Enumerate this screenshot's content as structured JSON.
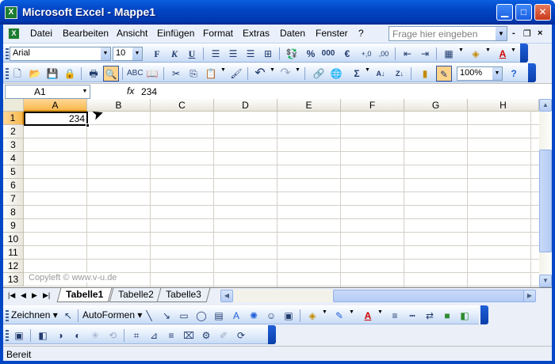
{
  "window": {
    "title": "Microsoft Excel - Mappe1",
    "app_icon": "X"
  },
  "titlebar_buttons": {
    "minimize": "▁",
    "maximize": "□",
    "close": "✕"
  },
  "menu": {
    "items": [
      {
        "label": "Datei"
      },
      {
        "label": "Bearbeiten"
      },
      {
        "label": "Ansicht"
      },
      {
        "label": "Einfügen"
      },
      {
        "label": "Format"
      },
      {
        "label": "Extras"
      },
      {
        "label": "Daten"
      },
      {
        "label": "Fenster"
      },
      {
        "label": "?"
      }
    ],
    "help_placeholder": "Frage hier eingeben",
    "doc_buttons": {
      "minimize": "-",
      "restore": "❐",
      "close": "×"
    }
  },
  "format_toolbar": {
    "font_name": "Arial",
    "font_size": "10",
    "bold": "F",
    "italic": "K",
    "underline": "U",
    "percent": "%",
    "thousands": "000",
    "euro": "€"
  },
  "standard_toolbar": {
    "zoom": "100%",
    "sigma": "Σ",
    "sort_asc": "A↓",
    "sort_desc": "Z↓"
  },
  "formula_bar": {
    "name_box": "A1",
    "fx": "fx",
    "value": "234"
  },
  "grid": {
    "columns": [
      "A",
      "B",
      "C",
      "D",
      "E",
      "F",
      "G",
      "H"
    ],
    "rows": [
      "1",
      "2",
      "3",
      "4",
      "5",
      "6",
      "7",
      "8",
      "9",
      "10",
      "11",
      "12",
      "13"
    ],
    "active_cell_value": "234",
    "watermark": "Copyleft © www.v-u.de"
  },
  "sheets": {
    "tabs": [
      {
        "label": "Tabelle1"
      },
      {
        "label": "Tabelle2"
      },
      {
        "label": "Tabelle3"
      }
    ],
    "nav": [
      "|◀",
      "◀",
      "▶",
      "▶|"
    ]
  },
  "drawing_toolbar": {
    "draw": "Zeichnen ▾",
    "autoshapes": "AutoFormen ▾"
  },
  "status": {
    "text": "Bereit"
  },
  "colors": {
    "title_blue": "#0047c6",
    "highlight": "#ffd38a",
    "selected_header": "#f8b94d"
  }
}
